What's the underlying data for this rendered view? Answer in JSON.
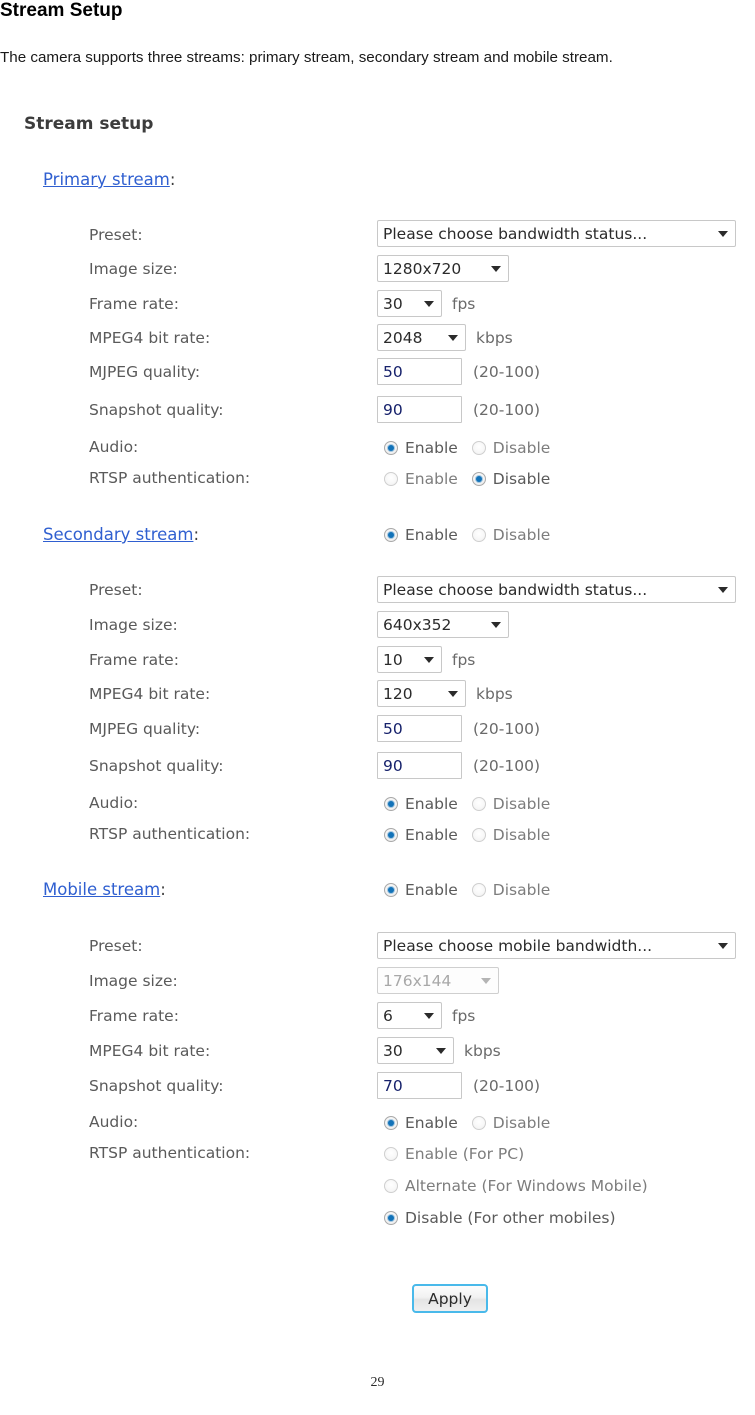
{
  "document": {
    "title": "Stream Setup",
    "intro": "The camera supports three streams: primary stream, secondary stream and mobile stream.",
    "page_number": "29"
  },
  "panel": {
    "title": "Stream setup",
    "apply_label": "Apply"
  },
  "labels": {
    "preset": "Preset:",
    "image_size": "Image size:",
    "frame_rate": "Frame rate:",
    "mpeg4_bit_rate": "MPEG4 bit rate:",
    "mjpeg_quality": "MJPEG quality:",
    "snapshot_quality": "Snapshot quality:",
    "audio": "Audio:",
    "rtsp_auth": "RTSP authentication:"
  },
  "units": {
    "fps": "fps",
    "kbps": "kbps",
    "range": "(20-100)"
  },
  "radio_labels": {
    "enable": "Enable",
    "disable": "Disable",
    "enable_for_pc": "Enable (For PC)",
    "alternate_windows_mobile": "Alternate (For Windows Mobile)",
    "disable_other_mobiles": "Disable (For other mobiles)"
  },
  "primary": {
    "heading": "Primary stream",
    "heading_colon": ":",
    "preset": "Please choose bandwidth status...",
    "image_size": "1280x720",
    "frame_rate": "30",
    "mpeg4_bit_rate": "2048",
    "mjpeg_quality": "50",
    "snapshot_quality": "90",
    "audio_selected": "Enable",
    "rtsp_selected": "Disable"
  },
  "secondary": {
    "heading": "Secondary stream",
    "heading_colon": ":",
    "enabled_selected": "Enable",
    "preset": "Please choose bandwidth status...",
    "image_size": "640x352",
    "frame_rate": "10",
    "mpeg4_bit_rate": "120",
    "mjpeg_quality": "50",
    "snapshot_quality": "90",
    "audio_selected": "Enable",
    "rtsp_selected": "Enable"
  },
  "mobile": {
    "heading": "Mobile stream",
    "heading_colon": ":",
    "enabled_selected": "Enable",
    "preset": "Please choose mobile bandwidth...",
    "image_size": "176x144",
    "image_size_disabled": true,
    "frame_rate": "6",
    "mpeg4_bit_rate": "30",
    "snapshot_quality": "70",
    "audio_selected": "Enable",
    "rtsp_selected": "Disable (For other mobiles)"
  },
  "colors": {
    "link": "#2f5fd0",
    "label": "#5a5a5a",
    "radio_accent": "#1272b8",
    "button_border": "#49b9ea",
    "input_border": "#c8c8c8"
  }
}
